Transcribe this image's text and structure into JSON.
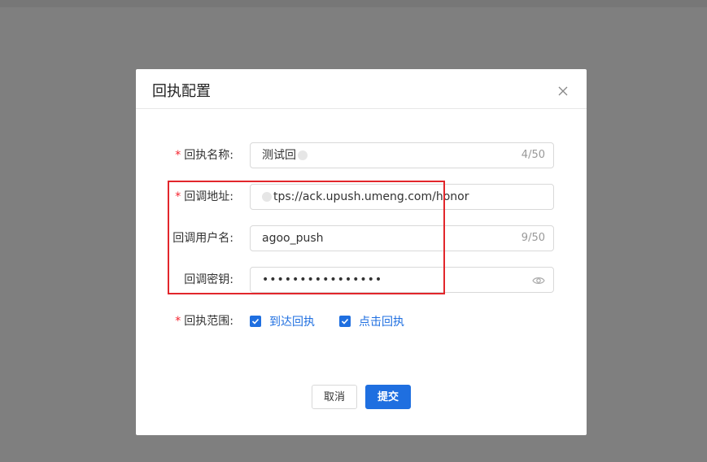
{
  "dialog": {
    "title": "回执配置",
    "close_icon": "close-icon"
  },
  "form": {
    "name": {
      "label": "回执名称:",
      "required_mark": "*",
      "value": "测试回",
      "count": "4/50"
    },
    "url": {
      "label": "回调地址:",
      "required_mark": "*",
      "value": "tps://ack.upush.umeng.com/honor"
    },
    "username": {
      "label": "回调用户名:",
      "value": "agoo_push",
      "count": "9/50"
    },
    "secret": {
      "label": "回调密钥:",
      "value": "••••••••••••••••",
      "eye_icon": "eye-icon"
    },
    "scope": {
      "label": "回执范围:",
      "required_mark": "*",
      "options": [
        {
          "label": "到达回执",
          "checked": true
        },
        {
          "label": "点击回执",
          "checked": true
        }
      ]
    }
  },
  "buttons": {
    "cancel": "取消",
    "submit": "提交"
  },
  "colors": {
    "primary": "#1f6fe0",
    "required": "#f5222d",
    "highlight": "#e2262b",
    "overlay": "#7f7f7f"
  }
}
